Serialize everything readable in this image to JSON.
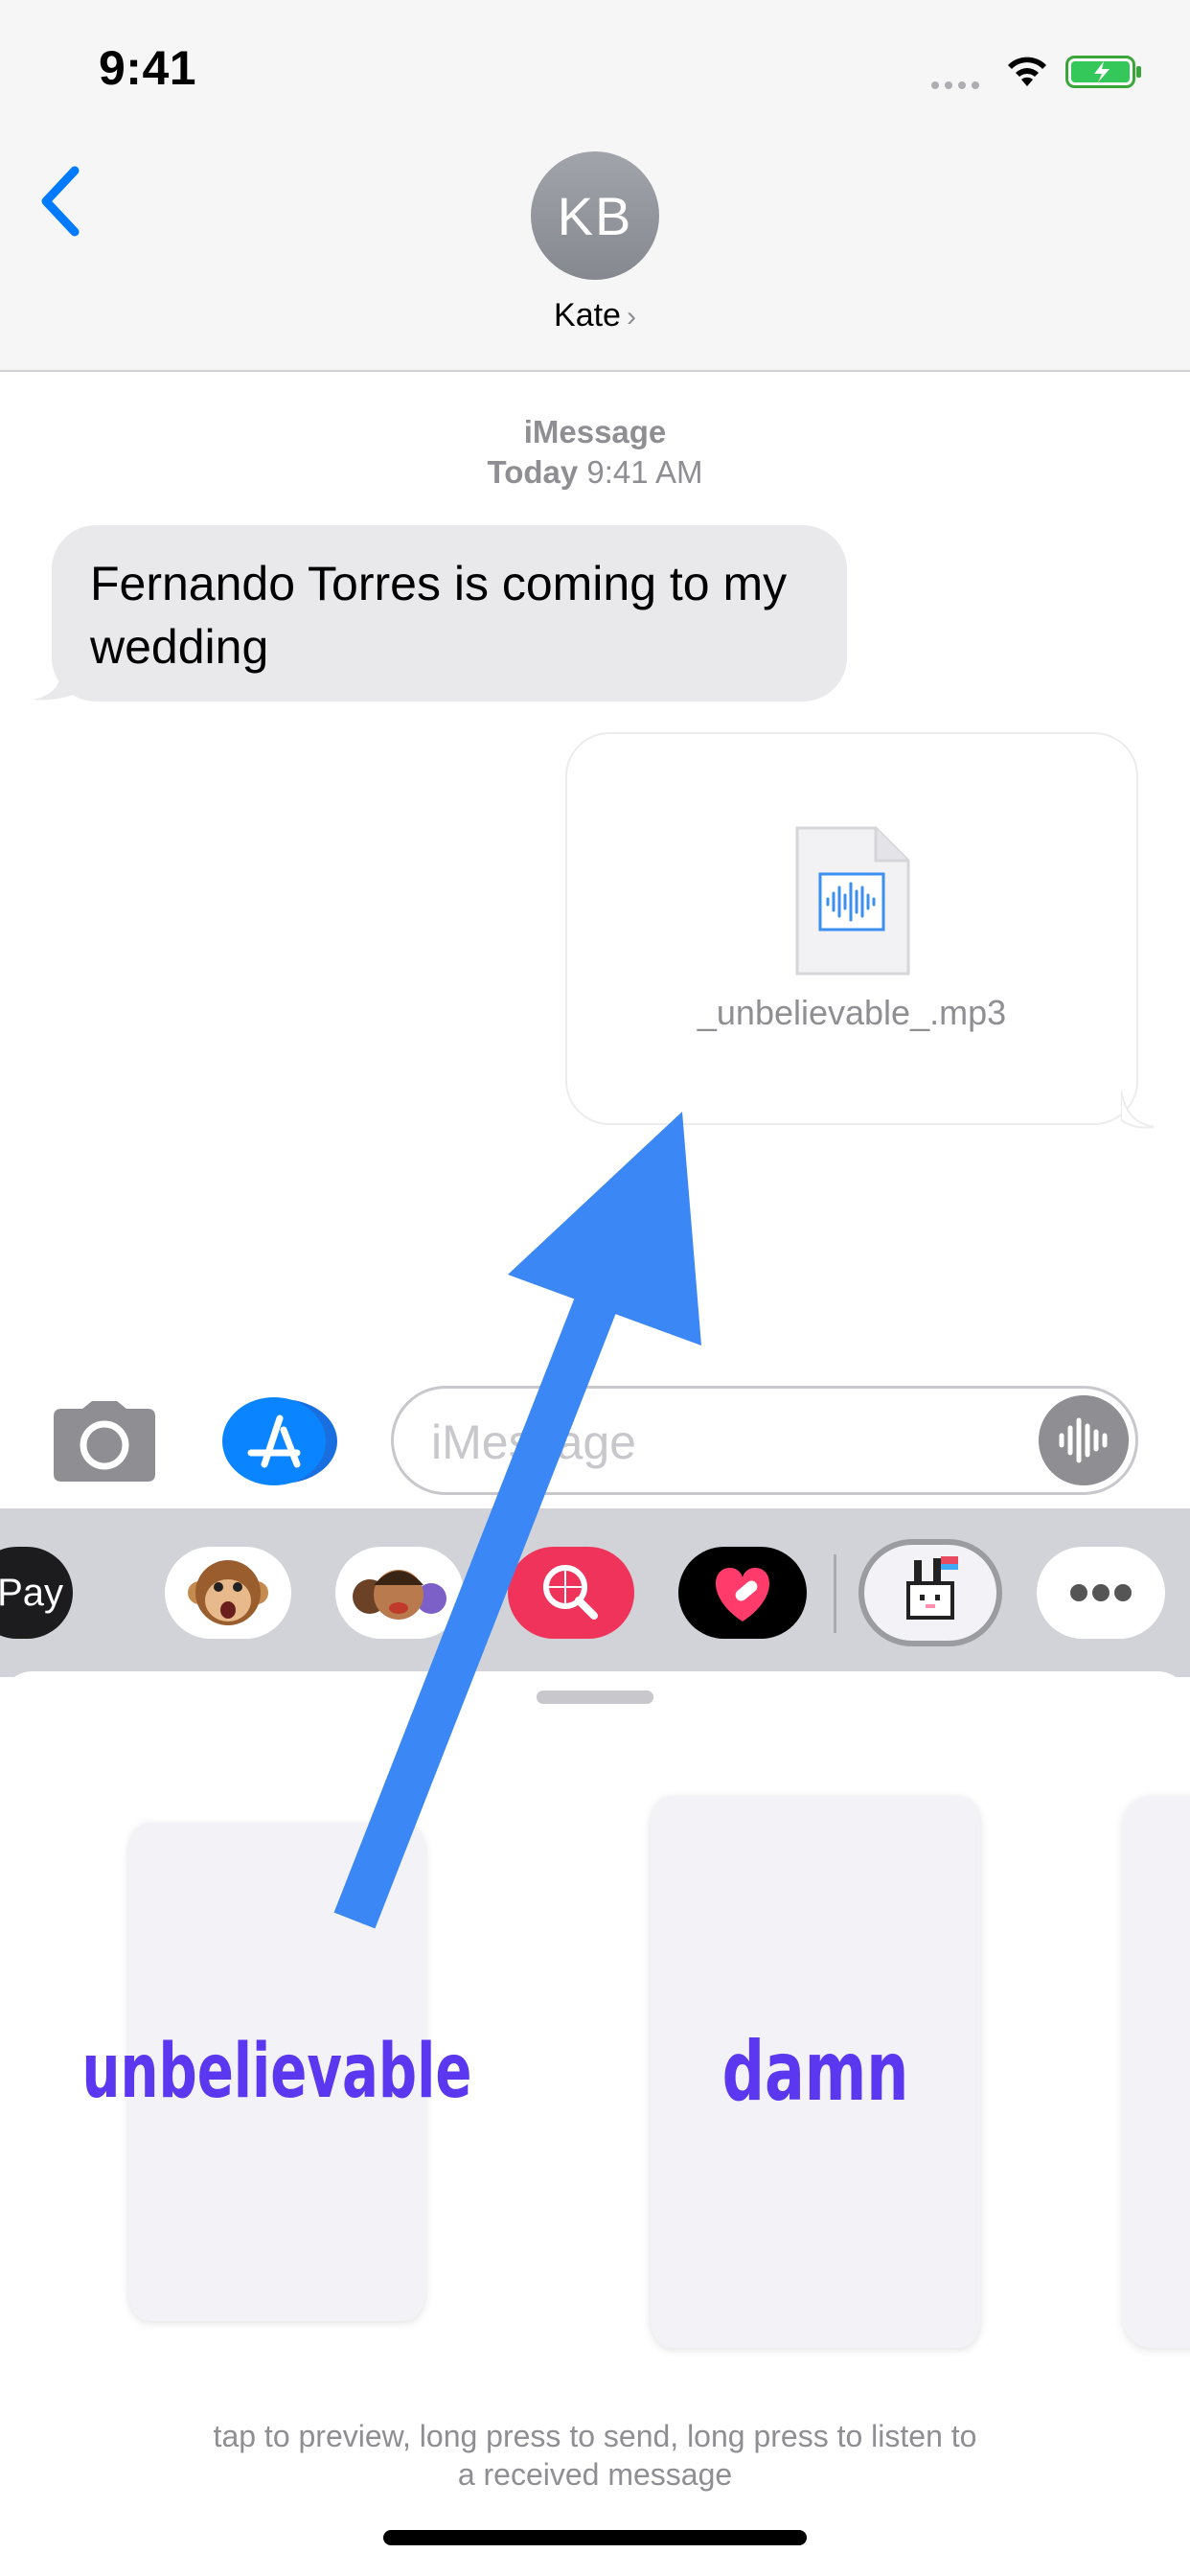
{
  "status_bar": {
    "time": "9:41"
  },
  "header": {
    "avatar_initials": "KB",
    "contact_name": "Kate"
  },
  "conversation": {
    "service": "iMessage",
    "timestamp_day": "Today",
    "timestamp_time": "9:41 AM",
    "incoming_message": "Fernando Torres is coming to my wedding",
    "outgoing_attachment": "_unbelievable_.mp3"
  },
  "input": {
    "placeholder": "iMessage"
  },
  "app_strip": {
    "apple_pay_label": "Pay"
  },
  "drawer": {
    "cards": [
      "unbelievable",
      "damn"
    ],
    "hint_line1": "tap to preview, long press to send, long press to listen to",
    "hint_line2": "a received message"
  },
  "colors": {
    "accent": "#007aff",
    "card_text": "#5b37f0",
    "arrow": "#3a87f5"
  }
}
